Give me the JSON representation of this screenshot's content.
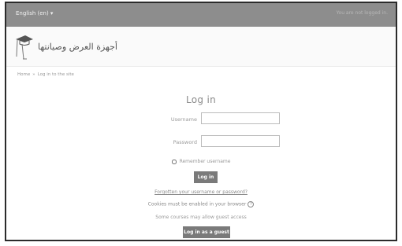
{
  "topbar": {
    "language": "English (en) ▾",
    "login_status": "You are not logged in."
  },
  "header": {
    "site_name": "أجهزة العرض وصيانتها"
  },
  "breadcrumb": {
    "home": "Home",
    "separator": "»",
    "current": "Log in to the site"
  },
  "login": {
    "title": "Log in",
    "username_label": "Username",
    "username_value": "",
    "password_label": "Password",
    "password_value": "",
    "remember_label": "Remember username",
    "login_button": "Log in",
    "forgot_link": "Forgotten your username or password?",
    "cookies_text": "Cookies must be enabled in your browser",
    "help_icon_glyph": "?",
    "guest_note": "Some courses may allow guest access",
    "guest_button": "Log in as a guest"
  },
  "colors": {
    "topbar": "#8d8d8d",
    "button": "#7a7a7a"
  }
}
